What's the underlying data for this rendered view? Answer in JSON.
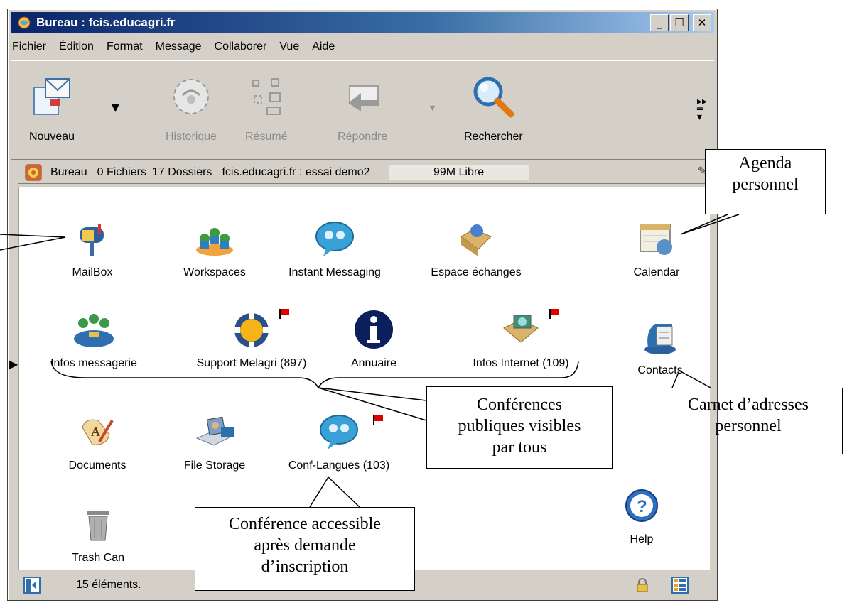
{
  "window": {
    "title": "Bureau : fcis.educagri.fr",
    "controls": {
      "minimize": "_",
      "maximize": "☐",
      "close": "✕"
    }
  },
  "menu": [
    "Fichier",
    "Édition",
    "Format",
    "Message",
    "Collaborer",
    "Vue",
    "Aide"
  ],
  "toolbar": {
    "new_label": "Nouveau",
    "history_label": "Historique",
    "summary_label": "Résumé",
    "reply_label": "Répondre",
    "search_label": "Rechercher",
    "more": "»"
  },
  "location": {
    "name": "Bureau",
    "files": "0 Fichiers",
    "folders": "17 Dossiers",
    "server": "fcis.educagri.fr : essai demo2",
    "free": "99M Libre"
  },
  "desktop": [
    {
      "label": "MailBox",
      "icon": "mailbox-icon"
    },
    {
      "label": "Workspaces",
      "icon": "workspaces-icon"
    },
    {
      "label": "Instant Messaging",
      "icon": "instant-messaging-icon"
    },
    {
      "label": "Espace échanges",
      "icon": "shared-folder-icon"
    },
    {
      "label": "Calendar",
      "icon": "calendar-icon"
    },
    {
      "label": "Infos messagerie",
      "icon": "conference-group-icon"
    },
    {
      "label": "Support Melagri (897)",
      "icon": "support-icon"
    },
    {
      "label": "Annuaire",
      "icon": "info-icon"
    },
    {
      "label": "Infos Internet (109)",
      "icon": "internet-folder-icon"
    },
    {
      "label": "Contacts",
      "icon": "contacts-icon"
    },
    {
      "label": "Documents",
      "icon": "documents-icon"
    },
    {
      "label": "File Storage",
      "icon": "file-storage-icon"
    },
    {
      "label": "Conf-Langues (103)",
      "icon": "conference-bubble-icon"
    },
    {
      "label": "Trash Can",
      "icon": "trash-icon"
    },
    {
      "label": "Help",
      "icon": "help-icon"
    }
  ],
  "status": {
    "count": "15 éléments."
  },
  "annotations": {
    "agenda": [
      "Agenda",
      "personnel"
    ],
    "public": [
      "Conférences",
      "publiques visibles",
      "par tous"
    ],
    "contacts": [
      "Carnet d’adresses",
      "personnel"
    ],
    "private": [
      "Conférence accessible",
      "après demande",
      "d’inscription"
    ]
  },
  "colors": {
    "title_start": "#0a246a",
    "title_end": "#a6caf0",
    "window_bg": "#d4d0c8",
    "flag_red": "#e00000"
  }
}
